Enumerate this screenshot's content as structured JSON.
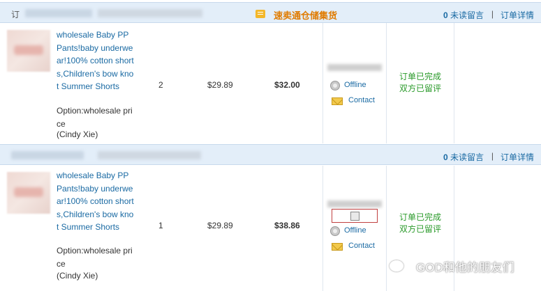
{
  "orders": [
    {
      "id_prefix": "订",
      "warehouse": "速卖通仓储集货",
      "messages": {
        "count": "0",
        "label": "未读留言"
      },
      "detail_link": "订单详情",
      "product": {
        "title": "wholesale Baby PP Pants!baby underwear!100% cotton shorts,Children's bow knot Summer Shorts",
        "option": "Option:wholesale price",
        "buyer": "(Cindy Xie)"
      },
      "qty": "2",
      "unit_price": "$29.89",
      "total": "$32.00",
      "seller_status": "Offline",
      "contact": "Contact",
      "status_line1": "订单已完成",
      "status_line2": "双方已留评"
    },
    {
      "id_prefix": "",
      "warehouse": "",
      "messages": {
        "count": "0",
        "label": "未读留言"
      },
      "detail_link": "订单详情",
      "product": {
        "title": "wholesale Baby PP Pants!baby underwear!100% cotton shorts,Children's bow knot Summer Shorts",
        "option": "Option:wholesale price",
        "buyer": "(Cindy Xie)"
      },
      "qty": "1",
      "unit_price": "$29.89",
      "total": "$38.86",
      "seller_status": "Offline",
      "contact": "Contact",
      "status_line1": "订单已完成",
      "status_line2": "双方已留评"
    }
  ],
  "watermark": "GOD和他的朋友们",
  "separator": "|"
}
